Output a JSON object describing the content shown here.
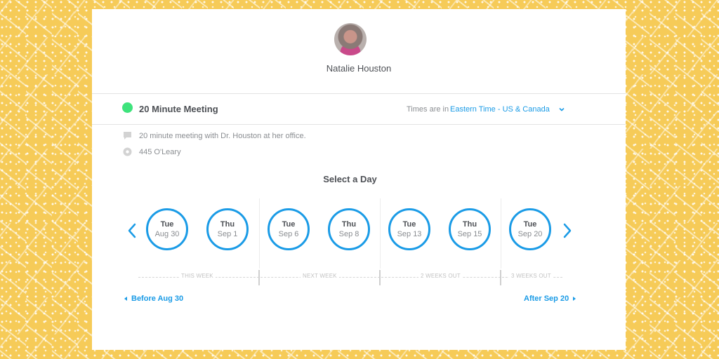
{
  "owner": {
    "name": "Natalie Houston"
  },
  "event": {
    "title": "20 Minute Meeting",
    "description": "20 minute meeting with Dr. Houston at her office.",
    "location": "445 O'Leary"
  },
  "timezone": {
    "label": "Times are in",
    "value": "Eastern Time - US & Canada"
  },
  "section_title": "Select a Day",
  "days": [
    {
      "dow": "Tue",
      "date": "Aug 30"
    },
    {
      "dow": "Thu",
      "date": "Sep 1"
    },
    {
      "dow": "Tue",
      "date": "Sep 6"
    },
    {
      "dow": "Thu",
      "date": "Sep 8"
    },
    {
      "dow": "Tue",
      "date": "Sep 13"
    },
    {
      "dow": "Thu",
      "date": "Sep 15"
    },
    {
      "dow": "Tue",
      "date": "Sep 20"
    }
  ],
  "weeks": [
    "THIS WEEK",
    "NEXT WEEK",
    "2 WEEKS OUT",
    "3 WEEKS OUT"
  ],
  "pagination": {
    "before": "Before Aug 30",
    "after": "After Sep 20"
  },
  "colors": {
    "accent": "#1a9be6",
    "event_dot": "#3ee37c",
    "background": "#f6cb58"
  }
}
